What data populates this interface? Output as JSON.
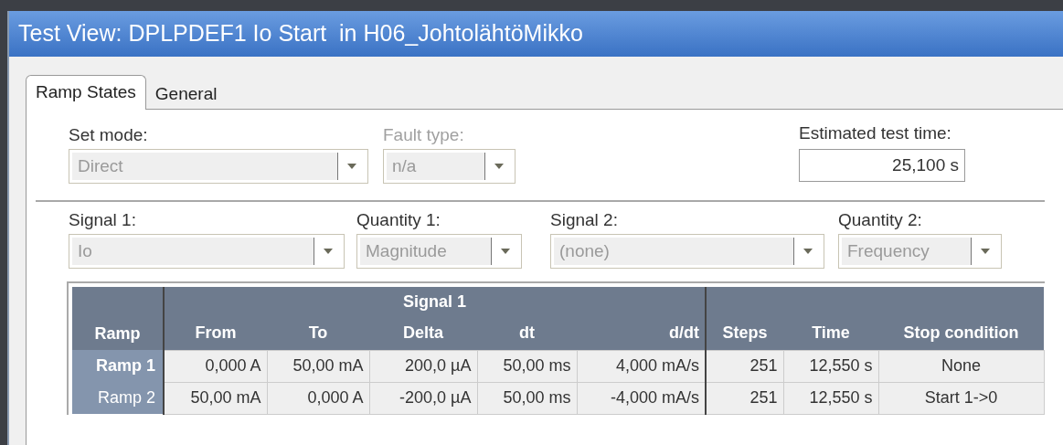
{
  "window": {
    "title": "Test View: DPLPDEF1 Io Start  in H06_JohtolähtöMikko"
  },
  "tabs": [
    {
      "label": "Ramp States",
      "selected": true
    },
    {
      "label": "General",
      "selected": false
    }
  ],
  "top_fields": [
    {
      "label": "Set mode:",
      "value": "Direct",
      "disabled": true
    },
    {
      "label": "Fault type:",
      "value": "n/a",
      "disabled": true,
      "label_disabled": true
    }
  ],
  "estimated_test_time": {
    "label": "Estimated test time:",
    "value": "25,100 s"
  },
  "signal_fields": [
    {
      "label": "Signal 1:",
      "value": "Io",
      "disabled": true
    },
    {
      "label": "Quantity 1:",
      "value": "Magnitude",
      "disabled": true
    },
    {
      "label": "Signal 2:",
      "value": "(none)",
      "disabled": true
    },
    {
      "label": "Quantity 2:",
      "value": "Frequency",
      "disabled": true
    }
  ],
  "table": {
    "group_header": "Signal 1",
    "columns": [
      "Ramp",
      "From",
      "To",
      "Delta",
      "dt",
      "d/dt",
      "Steps",
      "Time",
      "Stop condition"
    ],
    "rows": [
      {
        "selected": true,
        "cells": [
          "Ramp 1",
          "0,000 A",
          "50,00 mA",
          "200,0 µA",
          "50,00 ms",
          "4,000 mA/s",
          "251",
          "12,550 s",
          "None"
        ]
      },
      {
        "selected": false,
        "cells": [
          "Ramp 2",
          "50,00 mA",
          "0,000 A",
          "-200,0 µA",
          "50,00 ms",
          "-4,000 mA/s",
          "251",
          "12,550 s",
          "Start 1->0"
        ]
      }
    ]
  }
}
